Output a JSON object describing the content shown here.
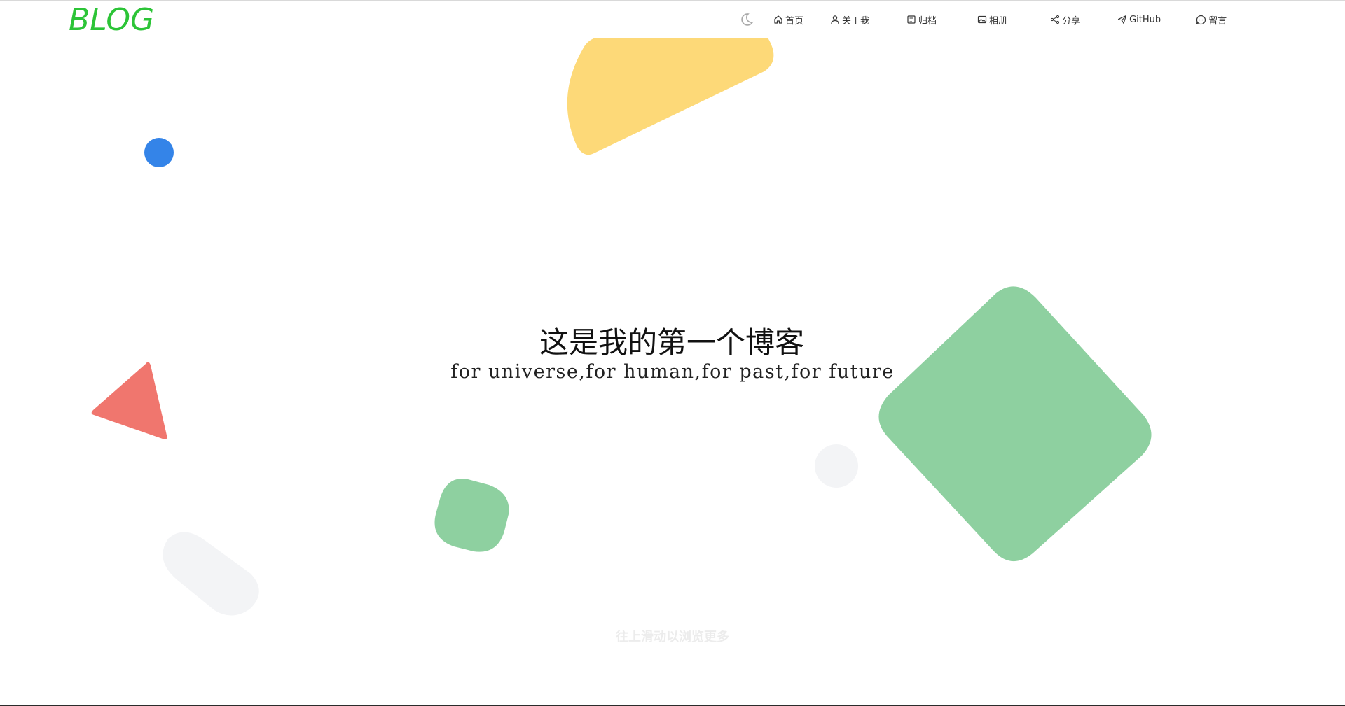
{
  "header": {
    "logo": "BLOG",
    "theme_toggle_icon": "moon-icon",
    "nav": [
      {
        "label": "首页",
        "icon": "home-icon"
      },
      {
        "label": "关于我",
        "icon": "user-icon"
      },
      {
        "label": "归档",
        "icon": "archive-icon"
      },
      {
        "label": "相册",
        "icon": "image-icon"
      },
      {
        "label": "分享",
        "icon": "share-icon"
      },
      {
        "label": "GitHub",
        "icon": "send-icon"
      },
      {
        "label": "留言",
        "icon": "chat-icon"
      }
    ]
  },
  "hero": {
    "title": "这是我的第一个博客",
    "subtitle": "for universe,for human,for past,for future"
  },
  "scroll_hint": "往上滑动以浏览更多",
  "colors": {
    "logo": "#2cc437",
    "yellow_shape": "#fdd978",
    "blue_dot": "#3484e8",
    "red_triangle": "#f0766e",
    "green_shape": "#8ed0a0",
    "gray_shape": "#f3f4f6"
  }
}
